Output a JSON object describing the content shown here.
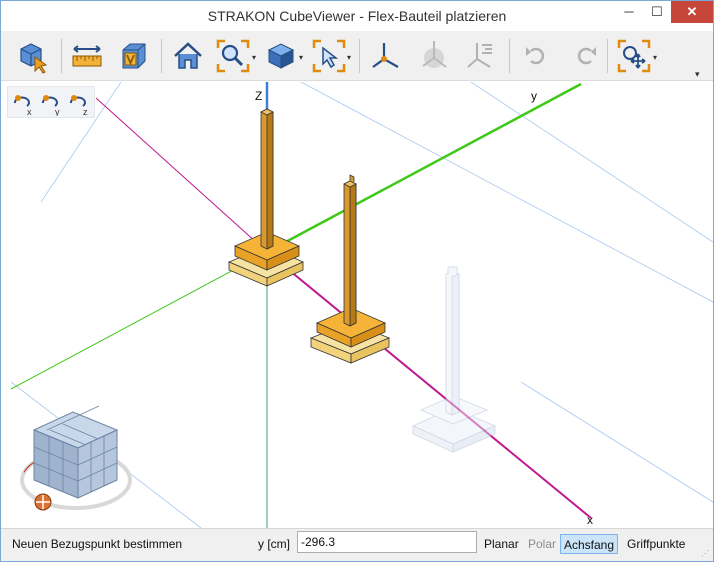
{
  "window": {
    "title": "STRAKON CubeViewer - Flex-Bauteil platzieren",
    "minimize": "─",
    "maximize": "☐",
    "close": "✕"
  },
  "toolbar": {
    "dropdown_glyph": "▾",
    "overflow_glyph": "▾",
    "icons": [
      "select-part-icon",
      "measure-icon",
      "view-cube-icon",
      "home-icon",
      "zoom-icon",
      "shading-icon",
      "selection-icon",
      "coordinate-system-icon",
      "orbit-icon",
      "align-icon",
      "undo-icon",
      "redo-icon",
      "snap-move-icon"
    ]
  },
  "viewport": {
    "axis_labels": {
      "z": "Z",
      "y": "y",
      "x": "x"
    },
    "axis_tools": [
      "rotate-x-icon",
      "rotate-y-icon",
      "rotate-z-icon"
    ],
    "axis_colors": {
      "x": "#c0188c",
      "y": "#44cc22",
      "z": "#3b7fd8"
    },
    "part_color": "#d89a2e"
  },
  "statusbar": {
    "message": "Neuen Bezugspunkt bestimmen",
    "coord_label": "y [cm]",
    "coord_value": "-296.3",
    "modes": {
      "planar": "Planar",
      "polar": "Polar",
      "achsfang": "Achsfang",
      "griffpunkte": "Griffpunkte"
    },
    "active_mode": "Achsfang"
  }
}
